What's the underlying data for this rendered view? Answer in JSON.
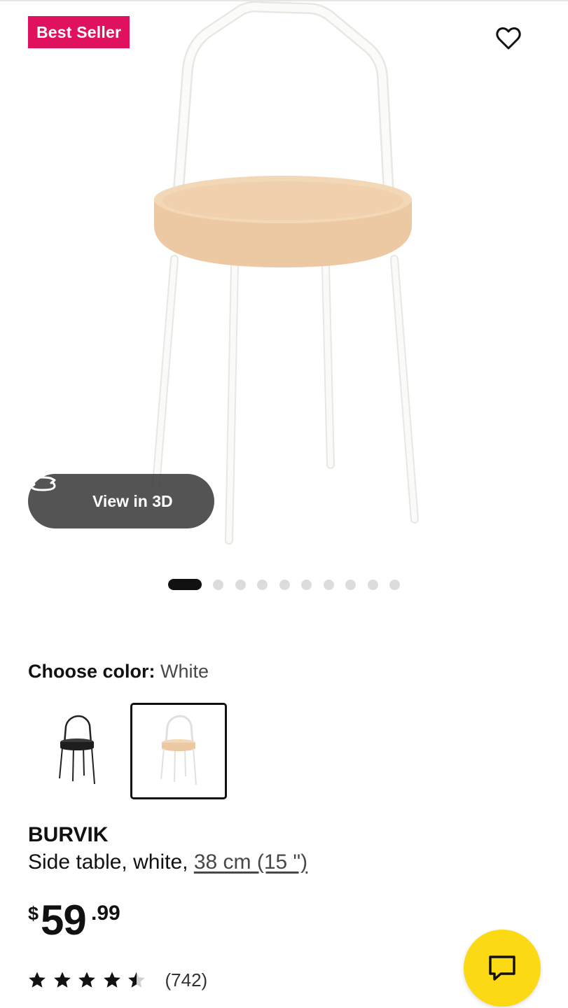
{
  "badge": {
    "label": "Best Seller",
    "color": "#e0115f"
  },
  "favorite": {
    "icon": "heart-outline-icon"
  },
  "view_3d": {
    "label": "View in 3D",
    "icon": "rotate-3d-icon"
  },
  "carousel": {
    "total_images": 10,
    "active_index": 0
  },
  "color_picker": {
    "label": "Choose color:",
    "selected_value": "White",
    "options": [
      {
        "name": "Black",
        "selected": false
      },
      {
        "name": "White",
        "selected": true
      }
    ]
  },
  "product": {
    "name": "BURVIK",
    "description": "Side table, white, ",
    "size": "38 cm (15 \")"
  },
  "price": {
    "currency": "$",
    "integer": "59",
    "decimal": ".99"
  },
  "rating": {
    "value": 4.5,
    "max": 5,
    "count": "(742)"
  },
  "chat": {
    "icon": "chat-bubble-icon",
    "color": "#fbd914"
  }
}
